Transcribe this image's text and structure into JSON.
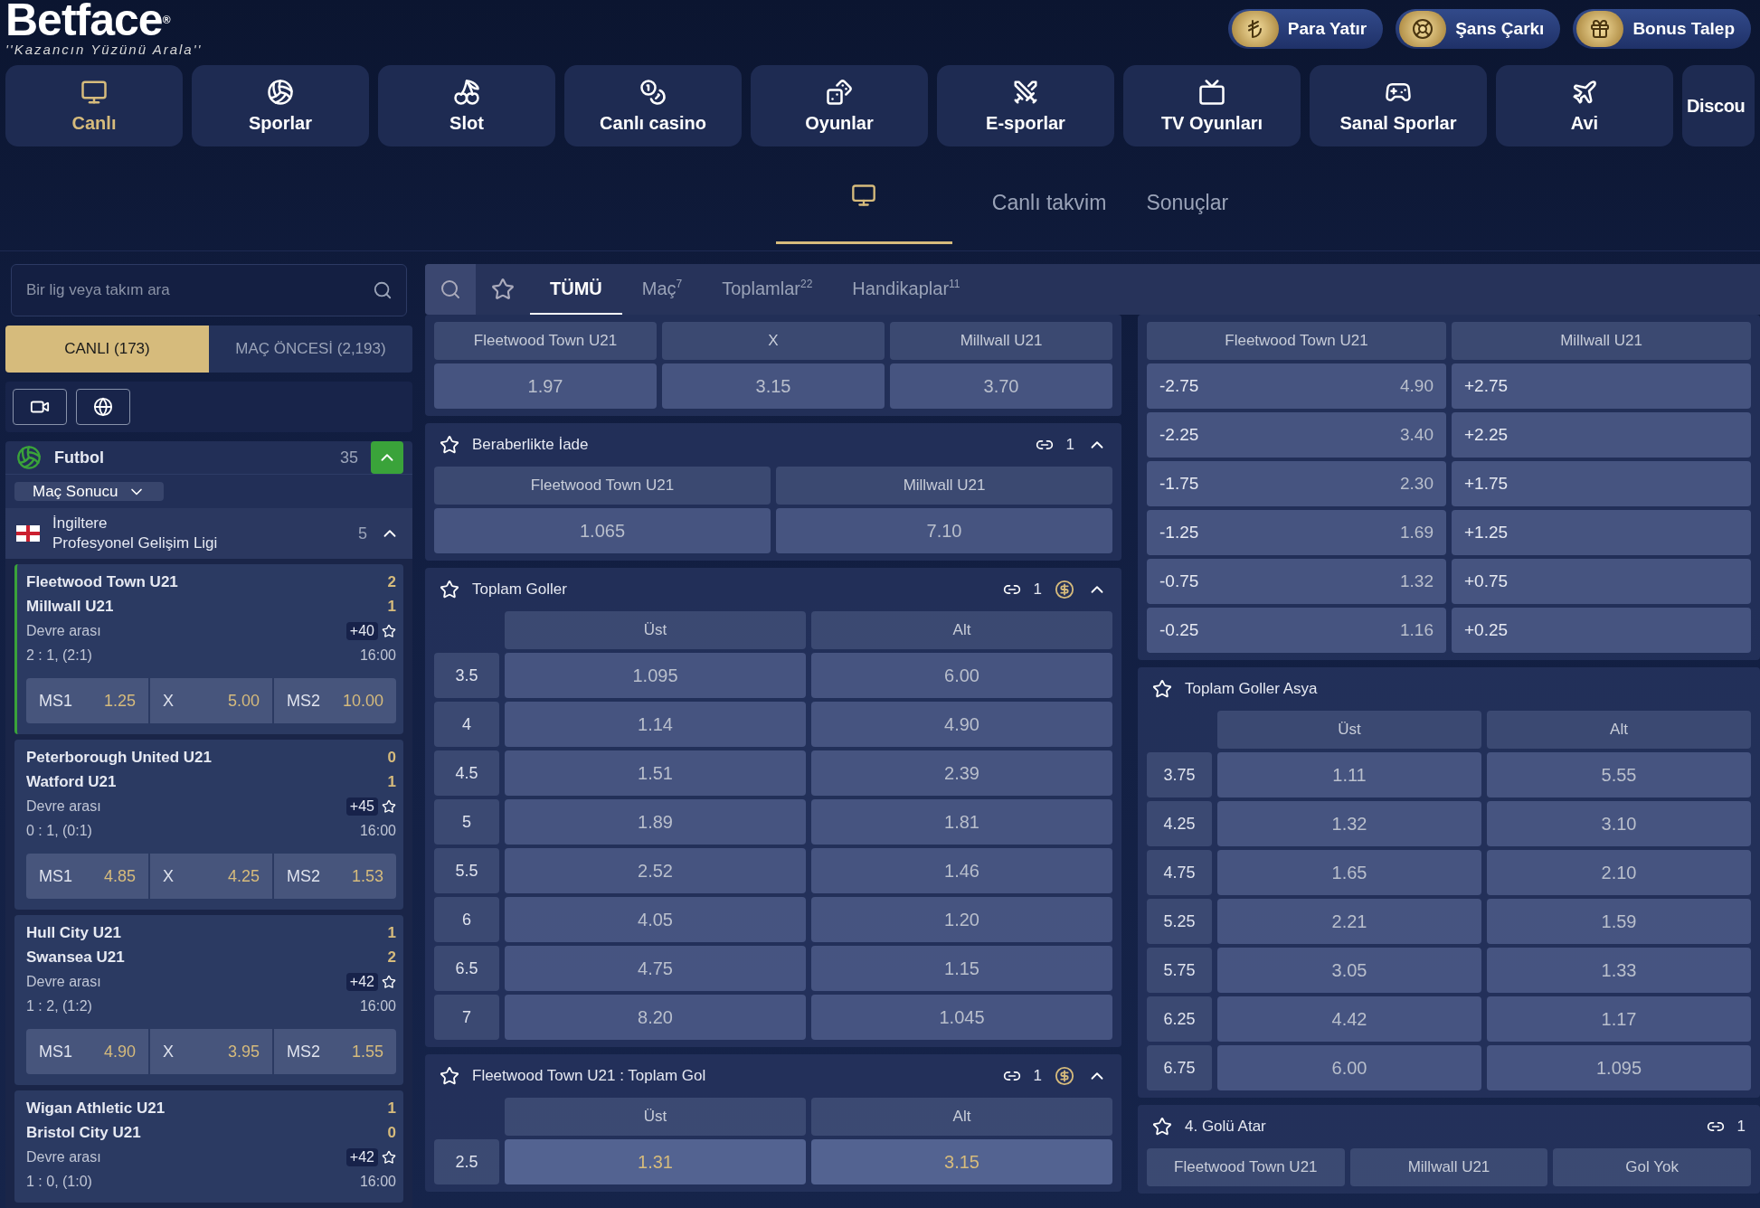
{
  "logo": {
    "name": "Betface",
    "registered": "®",
    "tagline": "''Kazancın Yüzünü Arala''"
  },
  "top_buttons": [
    {
      "label": "Para Yatır"
    },
    {
      "label": "Şans Çarkı"
    },
    {
      "label": "Bonus Talep"
    }
  ],
  "nav": [
    {
      "label": "Canlı",
      "selected": true
    },
    {
      "label": "Sporlar",
      "selected": false
    },
    {
      "label": "Slot",
      "selected": false
    },
    {
      "label": "Canlı casino",
      "selected": false
    },
    {
      "label": "Oyunlar",
      "selected": false
    },
    {
      "label": "E-sporlar",
      "selected": false
    },
    {
      "label": "TV Oyunları",
      "selected": false
    },
    {
      "label": "Sanal Sporlar",
      "selected": false
    },
    {
      "label": "Avi",
      "selected": false
    },
    {
      "label": "Discou",
      "selected": false
    }
  ],
  "subnav": [
    {
      "kind": "icon",
      "selected": true
    },
    {
      "kind": "text",
      "label": "Canlı takvim",
      "selected": false
    },
    {
      "kind": "text",
      "label": "Sonuçlar",
      "selected": false
    }
  ],
  "sidebar": {
    "search": {
      "placeholder": "Bir lig veya takım ara"
    },
    "tabs": [
      {
        "label": "CANLI (173)",
        "selected": true
      },
      {
        "label": "MAÇ ÖNCESİ (2,193)",
        "selected": false
      }
    ],
    "sport": {
      "name": "Futbol",
      "count": "35",
      "expanded": true
    },
    "market_select": "Maç Sonucu",
    "league": {
      "country": "İngiltere",
      "name": "Profesyonel Gelişim Ligi",
      "count": "5",
      "expanded": true
    },
    "matches": [
      {
        "home": "Fleetwood Town U21",
        "away": "Millwall U21",
        "home_score": "2",
        "away_score": "1",
        "status": "Devre arası",
        "more": "+40",
        "score_line": "2 : 1, (2:1)",
        "time": "16:00",
        "selected": true,
        "odds": [
          {
            "label": "MS1",
            "value": "1.25"
          },
          {
            "label": "X",
            "value": "5.00"
          },
          {
            "label": "MS2",
            "value": "10.00"
          }
        ]
      },
      {
        "home": "Peterborough United U21",
        "away": "Watford U21",
        "home_score": "0",
        "away_score": "1",
        "status": "Devre arası",
        "more": "+45",
        "score_line": "0 : 1, (0:1)",
        "time": "16:00",
        "selected": false,
        "odds": [
          {
            "label": "MS1",
            "value": "4.85"
          },
          {
            "label": "X",
            "value": "4.25"
          },
          {
            "label": "MS2",
            "value": "1.53"
          }
        ]
      },
      {
        "home": "Hull City U21",
        "away": "Swansea U21",
        "home_score": "1",
        "away_score": "2",
        "status": "Devre arası",
        "more": "+42",
        "score_line": "1 : 2, (1:2)",
        "time": "16:00",
        "selected": false,
        "odds": [
          {
            "label": "MS1",
            "value": "4.90"
          },
          {
            "label": "X",
            "value": "3.95"
          },
          {
            "label": "MS2",
            "value": "1.55"
          }
        ]
      },
      {
        "home": "Wigan Athletic U21",
        "away": "Bristol City U21",
        "home_score": "1",
        "away_score": "0",
        "status": "Devre arası",
        "more": "+42",
        "score_line": "1 : 0, (1:0)",
        "time": "16:00",
        "selected": false
      }
    ]
  },
  "market_tabs": [
    {
      "label": "TÜMÜ",
      "selected": true
    },
    {
      "label": "Maç",
      "count": "7",
      "selected": false
    },
    {
      "label": "Toplamlar",
      "count": "22",
      "selected": false
    },
    {
      "label": "Handikaplar",
      "count": "11",
      "selected": false
    }
  ],
  "left_markets": [
    {
      "kind": "grid",
      "locked": true,
      "columns": [
        "Fleetwood Town U21",
        "X",
        "Millwall U21"
      ],
      "odds": [
        "1.97",
        "3.15",
        "3.70"
      ]
    },
    {
      "kind": "grid",
      "title": "Beraberlikte İade",
      "link_count": "1",
      "expanded": true,
      "locked": true,
      "columns": [
        "Fleetwood Town U21",
        "Millwall U21"
      ],
      "odds": [
        "1.065",
        "7.10"
      ]
    },
    {
      "kind": "totals",
      "title": "Toplam Goller",
      "link_count": "1",
      "cashout": true,
      "expanded": true,
      "locked": true,
      "columns": [
        "Üst",
        "Alt"
      ],
      "rows": [
        {
          "line": "3.5",
          "odds": [
            "1.095",
            "6.00"
          ]
        },
        {
          "line": "4",
          "odds": [
            "1.14",
            "4.90"
          ]
        },
        {
          "line": "4.5",
          "odds": [
            "1.51",
            "2.39"
          ]
        },
        {
          "line": "5",
          "odds": [
            "1.89",
            "1.81"
          ]
        },
        {
          "line": "5.5",
          "odds": [
            "2.52",
            "1.46"
          ]
        },
        {
          "line": "6",
          "odds": [
            "4.05",
            "1.20"
          ]
        },
        {
          "line": "6.5",
          "odds": [
            "4.75",
            "1.15"
          ]
        },
        {
          "line": "7",
          "odds": [
            "8.20",
            "1.045"
          ]
        }
      ]
    },
    {
      "kind": "totals",
      "title": "Fleetwood Town U21 : Toplam Gol",
      "link_count": "1",
      "cashout": true,
      "expanded": true,
      "locked": false,
      "columns": [
        "Üst",
        "Alt"
      ],
      "rows": [
        {
          "line": "2.5",
          "odds": [
            "1.31",
            "3.15"
          ]
        }
      ]
    }
  ],
  "right_markets": [
    {
      "kind": "handicap",
      "locked": true,
      "columns": [
        "Fleetwood Town U21",
        "Millwall U21"
      ],
      "rows": [
        {
          "home_line": "-2.75",
          "home_odds": "4.90",
          "away_line": "+2.75"
        },
        {
          "home_line": "-2.25",
          "home_odds": "3.40",
          "away_line": "+2.25"
        },
        {
          "home_line": "-1.75",
          "home_odds": "2.30",
          "away_line": "+1.75"
        },
        {
          "home_line": "-1.25",
          "home_odds": "1.69",
          "away_line": "+1.25"
        },
        {
          "home_line": "-0.75",
          "home_odds": "1.32",
          "away_line": "+0.75"
        },
        {
          "home_line": "-0.25",
          "home_odds": "1.16",
          "away_line": "+0.25"
        }
      ]
    },
    {
      "kind": "totals",
      "title": "Toplam Goller Asya",
      "locked": true,
      "columns": [
        "Üst",
        "Alt"
      ],
      "rows": [
        {
          "line": "3.75",
          "odds": [
            "1.11",
            "5.55"
          ]
        },
        {
          "line": "4.25",
          "odds": [
            "1.32",
            "3.10"
          ]
        },
        {
          "line": "4.75",
          "odds": [
            "1.65",
            "2.10"
          ]
        },
        {
          "line": "5.25",
          "odds": [
            "2.21",
            "1.59"
          ]
        },
        {
          "line": "5.75",
          "odds": [
            "3.05",
            "1.33"
          ]
        },
        {
          "line": "6.25",
          "odds": [
            "4.42",
            "1.17"
          ]
        },
        {
          "line": "6.75",
          "odds": [
            "6.00",
            "1.095"
          ]
        }
      ]
    },
    {
      "kind": "grid",
      "title": "4. Golü Atar",
      "link_count": "1",
      "columns": [
        "Fleetwood Town U21",
        "Millwall U21",
        "Gol Yok"
      ]
    }
  ]
}
